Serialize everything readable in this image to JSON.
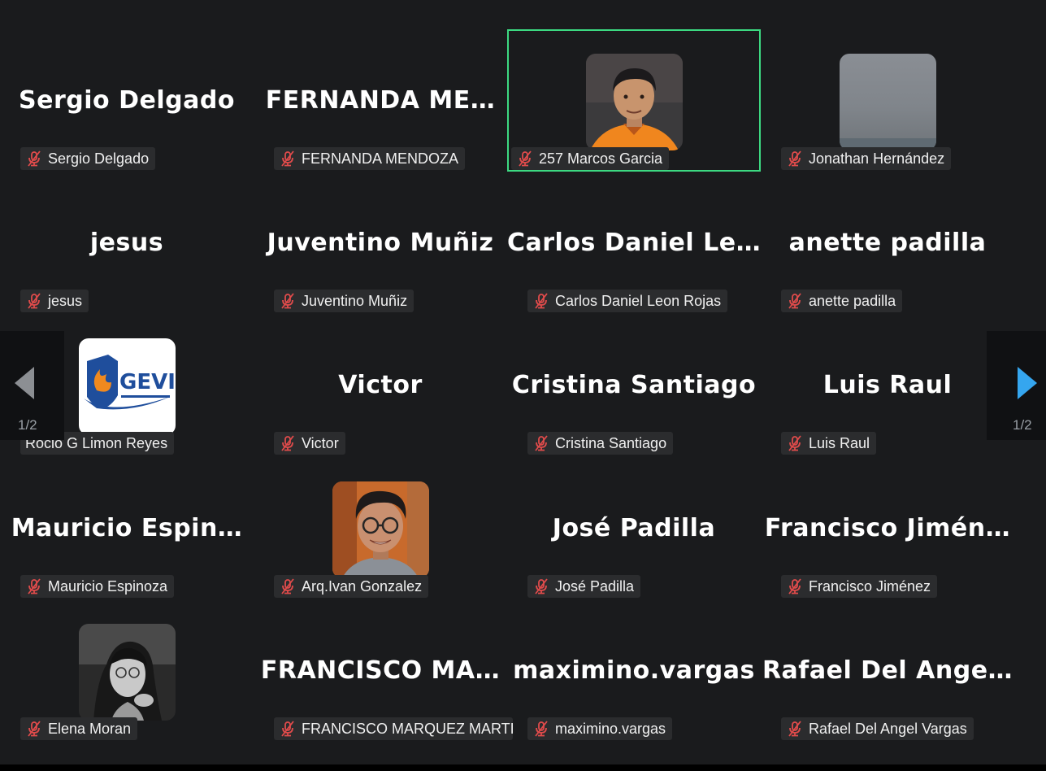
{
  "colors": {
    "background": "#1a1b1d",
    "active_border": "#3cd981",
    "muted_mic": "#e04b4b",
    "pager_arrow_left": "#8c8f93",
    "pager_arrow_right": "#35a6ef"
  },
  "pager": {
    "left_count": "1/2",
    "right_count": "1/2"
  },
  "participants": [
    {
      "display": "Sergio Delgado",
      "tag": "Sergio Delgado",
      "muted": true
    },
    {
      "display": "FERNANDA  ME…",
      "tag": "FERNANDA MENDOZA",
      "muted": true
    },
    {
      "display": "",
      "tag": "257 Marcos Garcia",
      "muted": true,
      "avatar": "photo-young-man-orange-shirt",
      "active": true
    },
    {
      "display": "",
      "tag": "Jonathan Hernández",
      "muted": true,
      "avatar": "blurred-gray-photo"
    },
    {
      "display": "jesus",
      "tag": "jesus",
      "muted": true
    },
    {
      "display": "Juventino Muñiz",
      "tag": "Juventino Muñiz",
      "muted": true
    },
    {
      "display": "Carlos  Daniel  Le…",
      "tag": "Carlos Daniel Leon Rojas",
      "muted": true
    },
    {
      "display": "anette padilla",
      "tag": "anette padilla",
      "muted": true
    },
    {
      "display": "",
      "tag": "Rocio G Limon Reyes",
      "muted": false,
      "avatar": "gevi-logo",
      "logo_text": "GEVI"
    },
    {
      "display": "Victor",
      "tag": "Victor",
      "muted": true
    },
    {
      "display": "Cristina Santiago",
      "tag": "Cristina Santiago",
      "muted": true
    },
    {
      "display": "Luis Raul",
      "tag": "Luis Raul",
      "muted": true
    },
    {
      "display": "Mauricio  Espin…",
      "tag": "Mauricio Espinoza",
      "muted": true
    },
    {
      "display": "",
      "tag": "Arq.Ivan Gonzalez",
      "muted": true,
      "avatar": "photo-man-glasses"
    },
    {
      "display": "José Padilla",
      "tag": "José Padilla",
      "muted": true
    },
    {
      "display": "Francisco  Jimén…",
      "tag": "Francisco Jiménez",
      "muted": true
    },
    {
      "display": "",
      "tag": "Elena Moran",
      "muted": true,
      "avatar": "photo-woman-grayscale"
    },
    {
      "display": "FRANCISCO  MA…",
      "tag": "FRANCISCO MARQUEZ MARTI…",
      "muted": true
    },
    {
      "display": "maximino.vargas",
      "tag": "maximino.vargas",
      "muted": true
    },
    {
      "display": "Rafael  Del  Ange…",
      "tag": "Rafael Del Angel Vargas",
      "muted": true
    }
  ]
}
